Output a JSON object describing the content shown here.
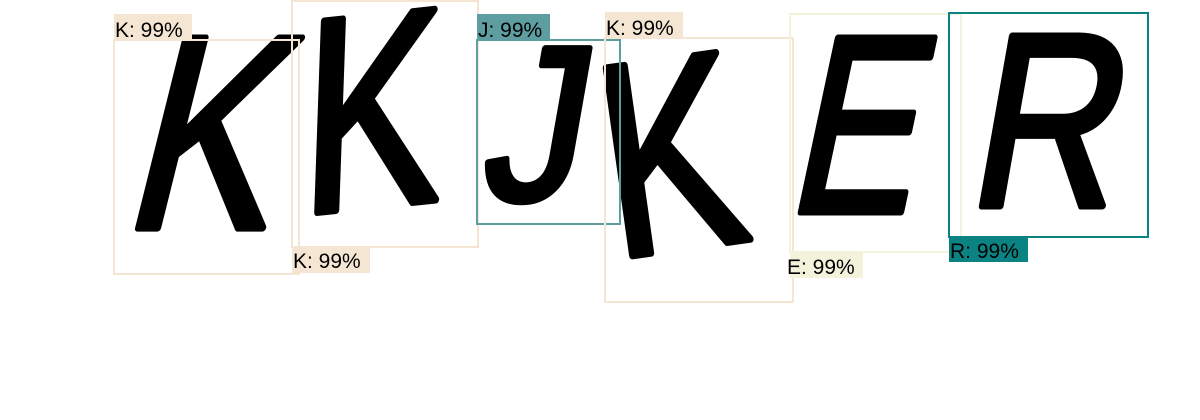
{
  "captcha": {
    "characters": [
      "K",
      "K",
      "J",
      "K",
      "E",
      "R"
    ],
    "glyph_color": "#000000"
  },
  "detections": [
    {
      "label": "K: 99%",
      "class": "K",
      "confidence": "99%",
      "color": "#f5e6d3"
    },
    {
      "label": "K: 99%",
      "class": "K",
      "confidence": "99%",
      "color": "#f5e6d3"
    },
    {
      "label": "J: 99%",
      "class": "J",
      "confidence": "99%",
      "color": "#5f9ea0"
    },
    {
      "label": "K: 99%",
      "class": "K",
      "confidence": "99%",
      "color": "#f5e6d3"
    },
    {
      "label": "E: 99%",
      "class": "E",
      "confidence": "99%",
      "color": "#f3f3dc"
    },
    {
      "label": "R: 99%",
      "class": "R",
      "confidence": "99%",
      "color": "#0b8383"
    }
  ]
}
